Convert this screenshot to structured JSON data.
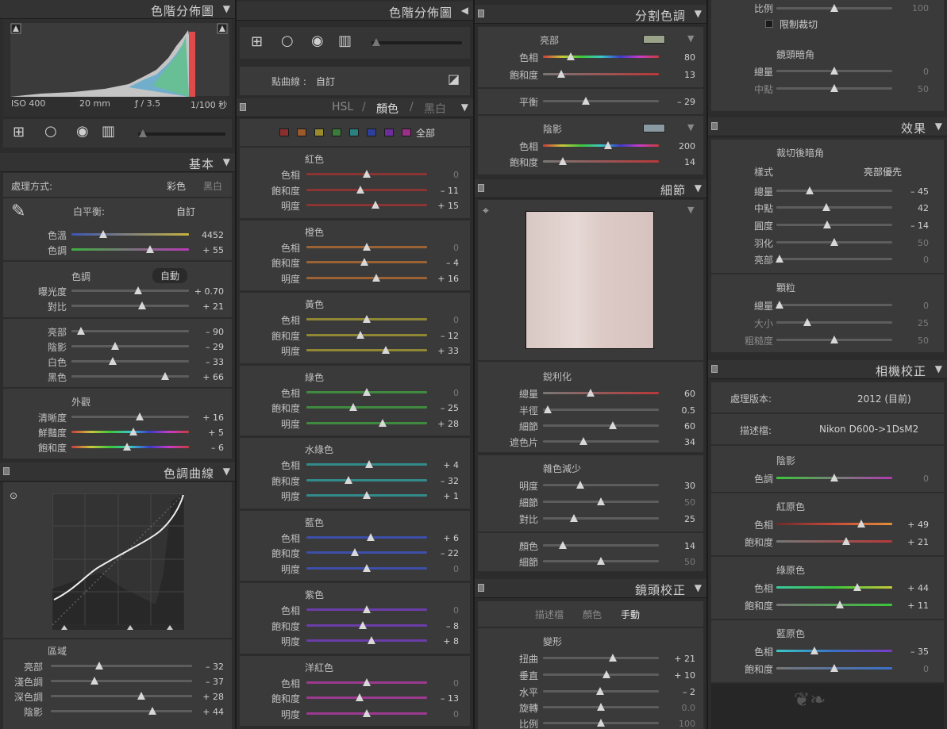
{
  "col1": {
    "histogram": {
      "title": "色階分佈圖",
      "iso": "ISO 400",
      "focal": "20 mm",
      "aperture": "ƒ / 3.5",
      "shutter": "1/100 秒"
    },
    "basic": {
      "title": "基本",
      "treatment_label": "處理方式:",
      "treatment_color": "彩色",
      "treatment_bw": "黑白",
      "wb_label": "白平衡:",
      "wb_value": "自訂",
      "temp": {
        "label": "色溫",
        "value": "4452",
        "pos": 0.27
      },
      "tint": {
        "label": "色調",
        "value": "+ 55",
        "pos": 0.67
      },
      "tone_label": "色調",
      "auto_label": "自動",
      "exposure": {
        "label": "曝光度",
        "value": "+ 0.70",
        "pos": 0.57
      },
      "contrast": {
        "label": "對比",
        "value": "+ 21",
        "pos": 0.6
      },
      "highlights": {
        "label": "亮部",
        "value": "– 90",
        "pos": 0.08
      },
      "shadows": {
        "label": "陰影",
        "value": "– 29",
        "pos": 0.37
      },
      "whites": {
        "label": "白色",
        "value": "– 33",
        "pos": 0.35
      },
      "blacks": {
        "label": "黑色",
        "value": "+ 66",
        "pos": 0.8
      },
      "presence_label": "外觀",
      "clarity": {
        "label": "清晰度",
        "value": "+ 16",
        "pos": 0.58
      },
      "vibrance": {
        "label": "鮮豔度",
        "value": "+ 5",
        "pos": 0.53
      },
      "saturation": {
        "label": "飽和度",
        "value": "– 6",
        "pos": 0.47
      }
    },
    "tonecurve": {
      "title": "色調曲線",
      "region_label": "區域",
      "highlights": {
        "label": "亮部",
        "value": "– 32",
        "pos": 0.34
      },
      "lights": {
        "label": "淺色調",
        "value": "– 37",
        "pos": 0.31
      },
      "darks": {
        "label": "深色調",
        "value": "+ 28",
        "pos": 0.64
      },
      "shadows": {
        "label": "陰影",
        "value": "+ 44",
        "pos": 0.72
      }
    }
  },
  "col2": {
    "histogram_title": "色階分佈圖",
    "point_curve_label": "點曲線 :",
    "point_curve_value": "自訂",
    "hsl_tabs": {
      "hsl": "HSL",
      "sep1": "/",
      "color": "顏色",
      "sep2": "/",
      "bw": "黑白"
    },
    "all_label": "全部",
    "groups": [
      {
        "name": "紅色",
        "grad": "g-red",
        "rows": [
          {
            "label": "色相",
            "value": "0",
            "pos": 0.5,
            "dim": true
          },
          {
            "label": "飽和度",
            "value": "– 11",
            "pos": 0.45
          },
          {
            "label": "明度",
            "value": "+ 15",
            "pos": 0.57
          }
        ]
      },
      {
        "name": "橙色",
        "grad": "g-orange",
        "rows": [
          {
            "label": "色相",
            "value": "0",
            "pos": 0.5,
            "dim": true
          },
          {
            "label": "飽和度",
            "value": "– 4",
            "pos": 0.48
          },
          {
            "label": "明度",
            "value": "+ 16",
            "pos": 0.58
          }
        ]
      },
      {
        "name": "黃色",
        "grad": "g-yellow",
        "rows": [
          {
            "label": "色相",
            "value": "0",
            "pos": 0.5,
            "dim": true
          },
          {
            "label": "飽和度",
            "value": "– 12",
            "pos": 0.45
          },
          {
            "label": "明度",
            "value": "+ 33",
            "pos": 0.66
          }
        ]
      },
      {
        "name": "綠色",
        "grad": "g-green",
        "rows": [
          {
            "label": "色相",
            "value": "0",
            "pos": 0.5,
            "dim": true
          },
          {
            "label": "飽和度",
            "value": "– 25",
            "pos": 0.39
          },
          {
            "label": "明度",
            "value": "+ 28",
            "pos": 0.63
          }
        ]
      },
      {
        "name": "水綠色",
        "grad": "g-aqua",
        "rows": [
          {
            "label": "色相",
            "value": "+ 4",
            "pos": 0.52
          },
          {
            "label": "飽和度",
            "value": "– 32",
            "pos": 0.35
          },
          {
            "label": "明度",
            "value": "+ 1",
            "pos": 0.5
          }
        ]
      },
      {
        "name": "藍色",
        "grad": "g-blue",
        "rows": [
          {
            "label": "色相",
            "value": "+ 6",
            "pos": 0.53
          },
          {
            "label": "飽和度",
            "value": "– 22",
            "pos": 0.4
          },
          {
            "label": "明度",
            "value": "0",
            "pos": 0.5,
            "dim": true
          }
        ]
      },
      {
        "name": "紫色",
        "grad": "g-purple",
        "rows": [
          {
            "label": "色相",
            "value": "0",
            "pos": 0.5,
            "dim": true
          },
          {
            "label": "飽和度",
            "value": "– 8",
            "pos": 0.47
          },
          {
            "label": "明度",
            "value": "+ 8",
            "pos": 0.54
          }
        ]
      },
      {
        "name": "洋紅色",
        "grad": "g-magenta",
        "rows": [
          {
            "label": "色相",
            "value": "0",
            "pos": 0.5,
            "dim": true
          },
          {
            "label": "飽和度",
            "value": "– 13",
            "pos": 0.44
          },
          {
            "label": "明度",
            "value": "0",
            "pos": 0.5,
            "dim": true
          }
        ]
      }
    ]
  },
  "col3": {
    "split_title": "分割色調",
    "highlights_label": "亮部",
    "hl_hue": {
      "label": "色相",
      "value": "80",
      "pos": 0.24
    },
    "hl_sat": {
      "label": "飽和度",
      "value": "13",
      "pos": 0.16
    },
    "balance": {
      "label": "平衡",
      "value": "– 29",
      "pos": 0.37
    },
    "shadows_label": "陰影",
    "sh_hue": {
      "label": "色相",
      "value": "200",
      "pos": 0.56
    },
    "sh_sat": {
      "label": "飽和度",
      "value": "14",
      "pos": 0.17
    },
    "detail_title": "細節",
    "sharpen_label": "銳利化",
    "amount": {
      "label": "總量",
      "value": "60",
      "pos": 0.41
    },
    "radius": {
      "label": "半徑",
      "value": "0.5",
      "pos": 0.04
    },
    "detail": {
      "label": "細節",
      "value": "60",
      "pos": 0.6
    },
    "masking": {
      "label": "遮色片",
      "value": "34",
      "pos": 0.35
    },
    "noise_label": "雜色減少",
    "luminance": {
      "label": "明度",
      "value": "30",
      "pos": 0.32
    },
    "lum_detail": {
      "label": "細節",
      "value": "50",
      "pos": 0.5,
      "dim": true
    },
    "lum_contrast": {
      "label": "對比",
      "value": "25",
      "pos": 0.27
    },
    "color": {
      "label": "顏色",
      "value": "14",
      "pos": 0.17
    },
    "color_detail": {
      "label": "細節",
      "value": "50",
      "pos": 0.5,
      "dim": true
    },
    "lens_title": "鏡頭校正",
    "lens_tabs": {
      "profile": "描述檔",
      "color": "顏色",
      "manual": "手動"
    },
    "transform_label": "變形",
    "distortion": {
      "label": "扭曲",
      "value": "+ 21",
      "pos": 0.6
    },
    "vertical": {
      "label": "垂直",
      "value": "+ 10",
      "pos": 0.55
    },
    "horizontal": {
      "label": "水平",
      "value": "– 2",
      "pos": 0.49
    },
    "rotate": {
      "label": "旋轉",
      "value": "0.0",
      "pos": 0.5,
      "dim": true
    },
    "scale": {
      "label": "比例",
      "value": "100",
      "pos": 0.5,
      "dim": true
    }
  },
  "col4": {
    "scale": {
      "label": "比例",
      "value": "100",
      "pos": 0.5,
      "dim": true
    },
    "constrain_label": "限制裁切",
    "lens_vig_label": "鏡頭暗角",
    "lv_amount": {
      "label": "總量",
      "value": "0",
      "pos": 0.5,
      "dim": true
    },
    "lv_mid": {
      "label": "中點",
      "value": "50",
      "pos": 0.5,
      "dim": true
    },
    "effects_title": "效果",
    "post_vig_label": "裁切後暗角",
    "style_label": "樣式",
    "style_value": "亮部優先",
    "pv_amount": {
      "label": "總量",
      "value": "– 45",
      "pos": 0.29
    },
    "pv_mid": {
      "label": "中點",
      "value": "42",
      "pos": 0.43
    },
    "pv_round": {
      "label": "圓度",
      "value": "– 14",
      "pos": 0.44
    },
    "pv_feather": {
      "label": "羽化",
      "value": "50",
      "pos": 0.5,
      "dim": true
    },
    "pv_hl": {
      "label": "亮部",
      "value": "0",
      "pos": 0.03,
      "dim": true
    },
    "grain_label": "顆粒",
    "gr_amount": {
      "label": "總量",
      "value": "0",
      "pos": 0.03,
      "dim": true
    },
    "gr_size": {
      "label": "大小",
      "value": "25",
      "pos": 0.27,
      "dim": true
    },
    "gr_rough": {
      "label": "粗糙度",
      "value": "50",
      "pos": 0.5,
      "dim": true
    },
    "camera_title": "相機校正",
    "process_label": "處理版本:",
    "process_value": "2012 (目前)",
    "profile_label": "描述檔:",
    "profile_value": "Nikon D600->1DsM2",
    "shadows_label": "陰影",
    "sh_tint": {
      "label": "色調",
      "value": "0",
      "pos": 0.5,
      "dim": true
    },
    "red_label": "紅原色",
    "red_hue": {
      "label": "色相",
      "value": "+ 49",
      "pos": 0.73
    },
    "red_sat": {
      "label": "飽和度",
      "value": "+ 21",
      "pos": 0.6
    },
    "green_label": "綠原色",
    "green_hue": {
      "label": "色相",
      "value": "+ 44",
      "pos": 0.7
    },
    "green_sat": {
      "label": "飽和度",
      "value": "+ 11",
      "pos": 0.55
    },
    "blue_label": "藍原色",
    "blue_hue": {
      "label": "色相",
      "value": "– 35",
      "pos": 0.33
    },
    "blue_sat": {
      "label": "飽和度",
      "value": "0",
      "pos": 0.5,
      "dim": true
    }
  }
}
